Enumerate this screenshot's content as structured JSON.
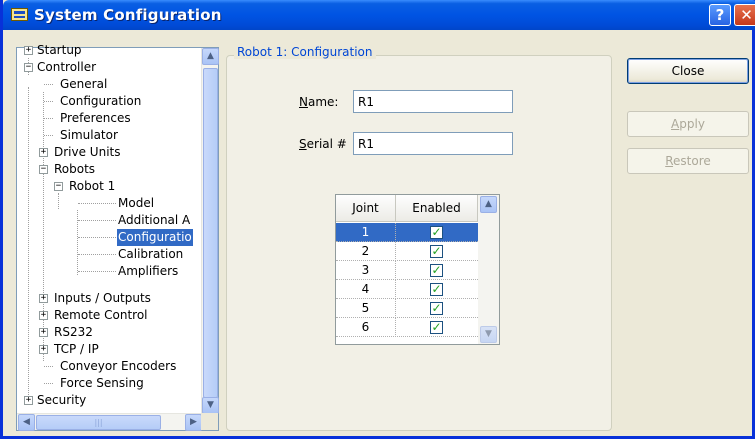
{
  "window": {
    "title": "System Configuration",
    "help_glyph": "?",
    "close_glyph": "✕"
  },
  "tree": {
    "items": [
      {
        "label": "Startup",
        "expander": "+"
      },
      {
        "label": "Controller",
        "expander": "−"
      },
      {
        "label": "General"
      },
      {
        "label": "Configuration"
      },
      {
        "label": "Preferences"
      },
      {
        "label": "Simulator"
      },
      {
        "label": "Drive Units",
        "expander": "+"
      },
      {
        "label": "Robots",
        "expander": "−"
      },
      {
        "label": "Robot 1",
        "expander": "−"
      },
      {
        "label": "Model"
      },
      {
        "label": "Additional A"
      },
      {
        "label": "Configuratio",
        "selected": true
      },
      {
        "label": "Calibration"
      },
      {
        "label": "Amplifiers"
      },
      {
        "label": "Inputs / Outputs",
        "expander": "+"
      },
      {
        "label": "Remote Control",
        "expander": "+"
      },
      {
        "label": "RS232",
        "expander": "+"
      },
      {
        "label": "TCP / IP",
        "expander": "+"
      },
      {
        "label": "Conveyor Encoders"
      },
      {
        "label": "Force Sensing"
      },
      {
        "label": "Security",
        "expander": "+"
      }
    ]
  },
  "panel": {
    "group_title": "Robot 1: Configuration",
    "name_label": "Name:",
    "name_value": "R1",
    "serial_label": "Serial #",
    "serial_value": "R1"
  },
  "joints_table": {
    "headers": [
      "Joint",
      "Enabled"
    ],
    "rows": [
      {
        "joint": "1",
        "enabled": true,
        "selected": true
      },
      {
        "joint": "2",
        "enabled": true
      },
      {
        "joint": "3",
        "enabled": true
      },
      {
        "joint": "4",
        "enabled": true
      },
      {
        "joint": "5",
        "enabled": true
      },
      {
        "joint": "6",
        "enabled": true
      }
    ]
  },
  "buttons": {
    "close": "Close",
    "apply": "Apply",
    "restore": "Restore"
  }
}
